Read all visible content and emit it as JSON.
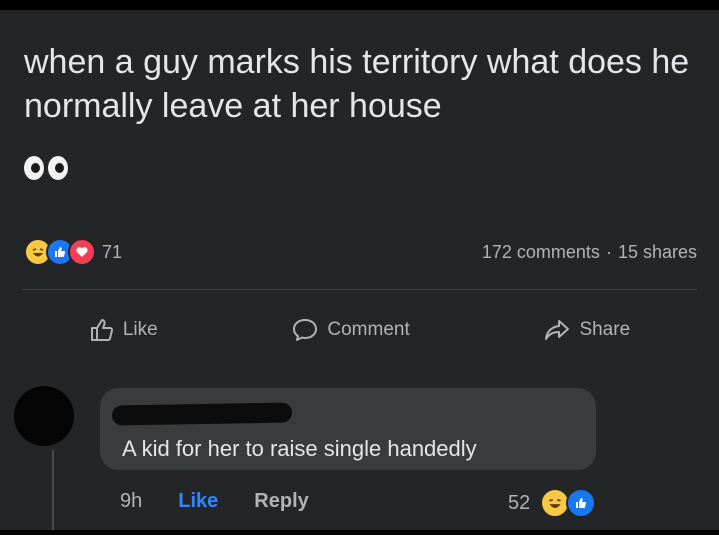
{
  "post": {
    "text": "when a guy marks his territory what does he normally leave at her house",
    "emoji_icon": "eyes-emoji-icon"
  },
  "reactions": {
    "icons": [
      "haha-reaction-icon",
      "like-reaction-icon",
      "love-reaction-icon"
    ],
    "count": "71",
    "comments": "172 comments",
    "separator": "·",
    "shares": "15 shares"
  },
  "actions": {
    "like": "Like",
    "comment": "Comment",
    "share": "Share"
  },
  "comment": {
    "text": "A kid for her to raise single handedly",
    "time": "9h",
    "like_label": "Like",
    "reply_label": "Reply",
    "reaction_count": "52",
    "reaction_icons": [
      "haha-reaction-icon",
      "like-reaction-icon"
    ]
  },
  "colors": {
    "background": "#242526",
    "text": "#e4e6eb",
    "muted": "#b0b3b8",
    "link_blue": "#2d88ff",
    "bubble": "#3a3b3c"
  }
}
